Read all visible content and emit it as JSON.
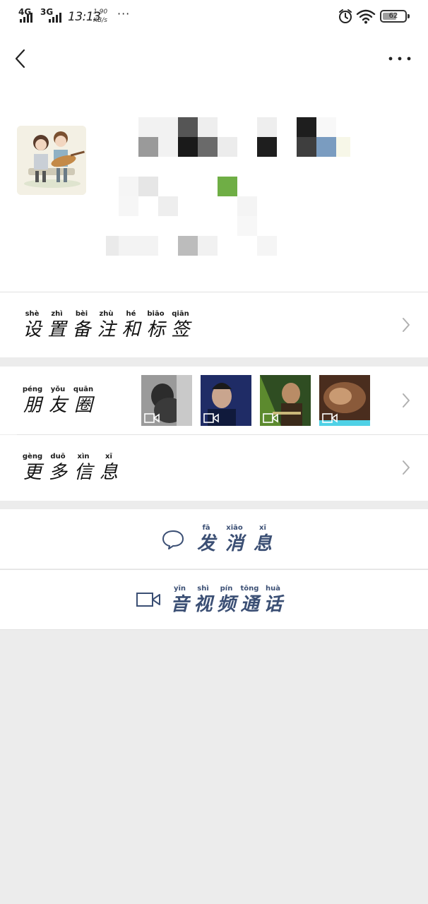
{
  "status_bar": {
    "network_1": "4G",
    "network_2": "3G",
    "time": "13:13",
    "speed_value": "1.90",
    "speed_unit": "KB/s",
    "more": "···",
    "battery_level": "62",
    "battery_fraction": 0.62,
    "icons": [
      "alarm-icon",
      "wifi-icon",
      "battery-icon"
    ]
  },
  "nav": {
    "back_icon": "back-arrow-icon",
    "more_icon": "more-dots-icon"
  },
  "profile": {
    "avatar_icon": "cartoon-couple-avatar",
    "name_redacted": true
  },
  "rows": {
    "set_remark": [
      {
        "py": "shè",
        "hz": "设"
      },
      {
        "py": "zhì",
        "hz": "置"
      },
      {
        "py": "bèi",
        "hz": "备"
      },
      {
        "py": "zhù",
        "hz": "注"
      },
      {
        "py": "hé",
        "hz": "和"
      },
      {
        "py": "biāo",
        "hz": "标"
      },
      {
        "py": "qiān",
        "hz": "签"
      }
    ],
    "moments": [
      {
        "py": "péng",
        "hz": "朋"
      },
      {
        "py": "yǒu",
        "hz": "友"
      },
      {
        "py": "quān",
        "hz": "圈"
      }
    ],
    "more_info": [
      {
        "py": "gèng",
        "hz": "更"
      },
      {
        "py": "duō",
        "hz": "多"
      },
      {
        "py": "xìn",
        "hz": "信"
      },
      {
        "py": "xī",
        "hz": "息"
      }
    ]
  },
  "moments_thumbs": [
    "video-thumbnail-1",
    "video-thumbnail-2",
    "video-thumbnail-3",
    "video-thumbnail-4"
  ],
  "actions": {
    "send_message": [
      {
        "py": "fā",
        "hz": "发"
      },
      {
        "py": "xiāo",
        "hz": "消"
      },
      {
        "py": "xī",
        "hz": "息"
      }
    ],
    "video_call": [
      {
        "py": "yīn",
        "hz": "音"
      },
      {
        "py": "shì",
        "hz": "视"
      },
      {
        "py": "pín",
        "hz": "频"
      },
      {
        "py": "tōng",
        "hz": "通"
      },
      {
        "py": "huà",
        "hz": "话"
      }
    ]
  },
  "colors": {
    "action_text": "#3b4f74",
    "background": "#ececec",
    "card": "#ffffff"
  }
}
